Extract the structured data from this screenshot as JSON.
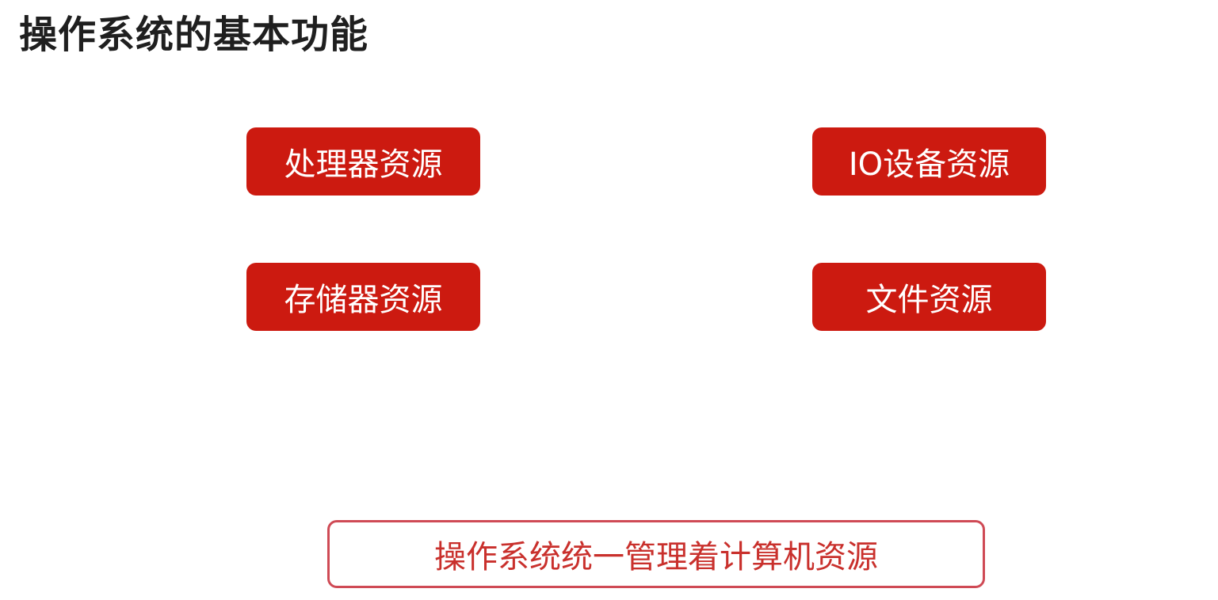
{
  "slide": {
    "title": "操作系统的基本功能",
    "resources": [
      {
        "label": "处理器资源"
      },
      {
        "label": "IO设备资源"
      },
      {
        "label": "存储器资源"
      },
      {
        "label": "文件资源"
      }
    ],
    "summary": "操作系统统一管理着计算机资源"
  },
  "colors": {
    "resource_fill": "#cc1a10",
    "summary_border": "#cf4a55",
    "summary_text": "#c9302c",
    "title_text": "#1f1f1f"
  }
}
